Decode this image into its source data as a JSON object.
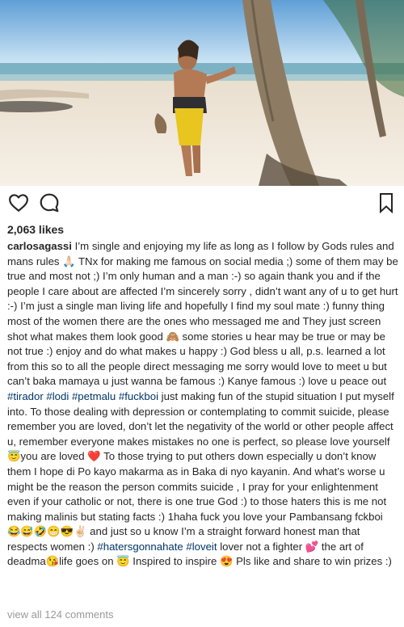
{
  "post": {
    "likes": "2,063 likes",
    "username": "carlosagassi",
    "caption_parts": [
      {
        "t": "text",
        "v": " I’m single and enjoying my life as long as I follow by Gods rules and mans rules 🙏🏻 TNx for making me famous on social media ;) some of them may be true and most not ;) I’m only human and a man :-) so again thank you and if the people I care about are affected I’m sincerely sorry , didn’t want any of u to get hurt :-) I’m just a single man living life and hopefully I find my soul mate :) funny thing most of the women there are the ones who messaged me and They just screen shot what makes them look good 🙈 some stories u hear may be true or may be not true :) enjoy and do what makes u happy :) God bless u all, p.s. learned a lot from this so to all the people direct messaging me sorry would love to meet u but can’t baka mamaya u just wanna be famous :) Kanye famous :) love u peace out "
      },
      {
        "t": "tag",
        "v": "#tirador"
      },
      {
        "t": "text",
        "v": " "
      },
      {
        "t": "tag",
        "v": "#lodi"
      },
      {
        "t": "text",
        "v": " "
      },
      {
        "t": "tag",
        "v": "#petmalu"
      },
      {
        "t": "text",
        "v": " "
      },
      {
        "t": "tag",
        "v": "#fuckboi"
      },
      {
        "t": "text",
        "v": " just making fun of the stupid situation I put myself into. To those dealing with depression or contemplating to commit suicide, please remember you are loved, don’t let the negativity of the world or other people affect u, remember everyone makes mistakes no one is perfect, so please love yourself 😇you are loved ❤️ To those trying to put others down especially u don’t know them I hope di Po kayo makarma as in Baka di nyo kayanin. And what’s worse u might be the reason the person commits suicide , I pray for your enlightenment even if your catholic or not, there is one true God :) to those haters this is me not making malinis but stating facts :) 1haha fuck you love your Pambansang fckboi 😂😅🤣😁😎✌🏻 and just so u know I’m a straight forward honest man that respects women :) "
      },
      {
        "t": "tag",
        "v": "#hatersgonnahate"
      },
      {
        "t": "text",
        "v": " "
      },
      {
        "t": "tag",
        "v": "#loveit"
      },
      {
        "t": "text",
        "v": " lover not a fighter 💕 the art of deadma😘life goes on 😇 Inspired to inspire 😍 Pls like and share to win prizes :)"
      }
    ],
    "view_all": "view all 124 comments"
  },
  "icons": {
    "like": "heart-outline-icon",
    "comment": "comment-bubble-icon",
    "save": "bookmark-icon"
  },
  "colors": {
    "text": "#262626",
    "hashtag": "#003569",
    "muted": "#999999"
  }
}
